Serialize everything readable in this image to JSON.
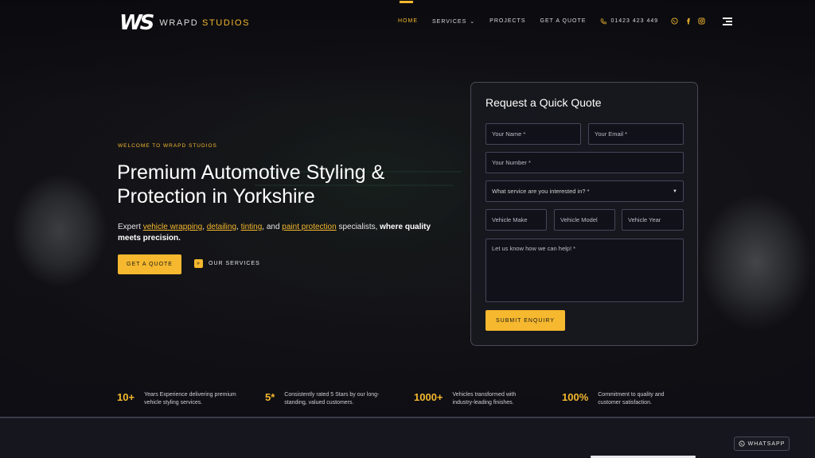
{
  "logo": {
    "mark": "WS",
    "name_main": "WRAPD",
    "name_accent": "STUDIOS"
  },
  "nav": {
    "items": [
      {
        "label": "HOME",
        "active": true
      },
      {
        "label": "SERVICES",
        "has_dropdown": true
      },
      {
        "label": "PROJECTS"
      },
      {
        "label": "GET A QUOTE"
      }
    ],
    "phone": "01423 423 449",
    "social_icons": [
      "whatsapp-icon",
      "facebook-icon",
      "instagram-icon"
    ],
    "menu_icon": "menu-icon"
  },
  "hero": {
    "eyebrow": "WELCOME TO WRAPD STUDIOS",
    "title_line1": "Premium Automotive Styling &",
    "title_line2": "Protection in Yorkshire",
    "sub_prefix": "Expert ",
    "sub_link1": "vehicle wrapping",
    "sub_sep1": ", ",
    "sub_link2": "detailing",
    "sub_sep2": ", ",
    "sub_link3": "tinting",
    "sub_sep3": ", and ",
    "sub_link4": "paint protection",
    "sub_mid": " specialists, ",
    "sub_bold": "where quality meets precision.",
    "cta_primary": "GET A QUOTE",
    "cta_secondary": "OUR SERVICES"
  },
  "quote_form": {
    "title": "Request a Quick Quote",
    "name_placeholder": "Your Name *",
    "email_placeholder": "Your Email *",
    "number_placeholder": "Your Number *",
    "service_select": "What service are you interested in? *",
    "make_placeholder": "Vehicle Make",
    "model_placeholder": "Vehicle Model",
    "year_placeholder": "Vehicle Year",
    "message_placeholder": "Let us know how we can help! *",
    "submit_label": "SUBMIT ENQUIRY"
  },
  "stats": [
    {
      "value": "10+",
      "text": "Years Experience delivering premium vehicle styling services."
    },
    {
      "value": "5*",
      "text": "Consistently rated 5 Stars by our long-standing, valued customers."
    },
    {
      "value": "1000+",
      "text": "Vehicles transformed with industry-leading finishes."
    },
    {
      "value": "100%",
      "text": "Commitment to quality and customer satisfaction."
    }
  ],
  "whatsapp_button": "WHATSAPP",
  "colors": {
    "accent": "#f5b82e",
    "background": "#121218",
    "card": "#181820"
  }
}
